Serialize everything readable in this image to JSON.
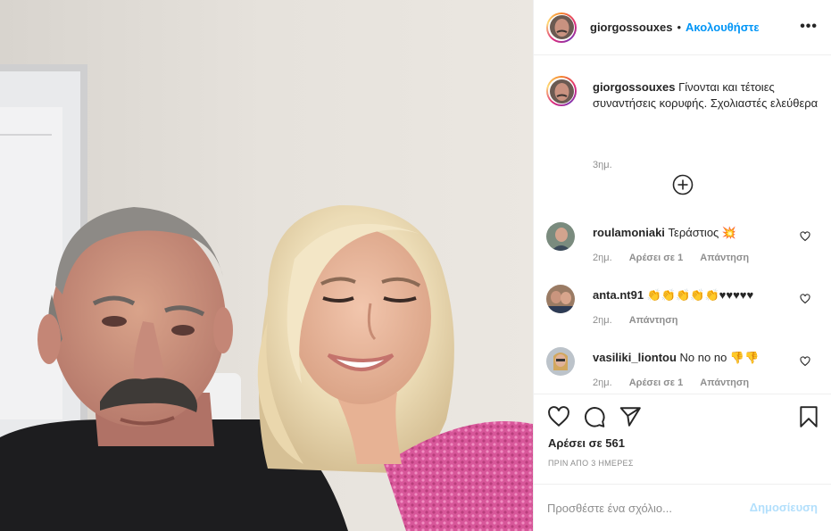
{
  "post": {
    "username": "giorgossouxes",
    "separator": "•",
    "follow_label": "Ακολουθήστε",
    "more_icon": "more-options-icon",
    "caption": {
      "username": "giorgossouxes",
      "text": "Γίνονται και τέτοιες συναντήσεις κορυφής. Σχολιαστές ελεύθερα",
      "time": "3ημ."
    },
    "load_more_icon": "plus-circle-icon",
    "comments": [
      {
        "username": "roulamoniaki",
        "text": "Τεράστιος 💥",
        "time": "2ημ.",
        "likes": "Αρέσει σε 1",
        "reply": "Απάντηση"
      },
      {
        "username": "anta.nt91",
        "text": "👏👏👏👏👏♥♥♥♥♥",
        "time": "2ημ.",
        "likes": "",
        "reply": "Απάντηση"
      },
      {
        "username": "vasiliki_liontou",
        "text": "No no no 👎👎",
        "time": "2ημ.",
        "likes": "Αρέσει σε 1",
        "reply": "Απάντηση"
      }
    ],
    "likes_text": "Αρέσει σε 561",
    "date_text": "ΠΡΙΝ ΑΠΟ 3 ΗΜΕΡΕΣ",
    "comment_placeholder": "Προσθέστε ένα σχόλιο...",
    "post_label": "Δημοσίευση"
  },
  "colors": {
    "link_blue": "#0095f6",
    "post_disabled": "#b2dffc",
    "muted": "#8e8e8e",
    "text": "#262626",
    "divider": "#efefef",
    "dress_pink": "#d85a9a"
  }
}
